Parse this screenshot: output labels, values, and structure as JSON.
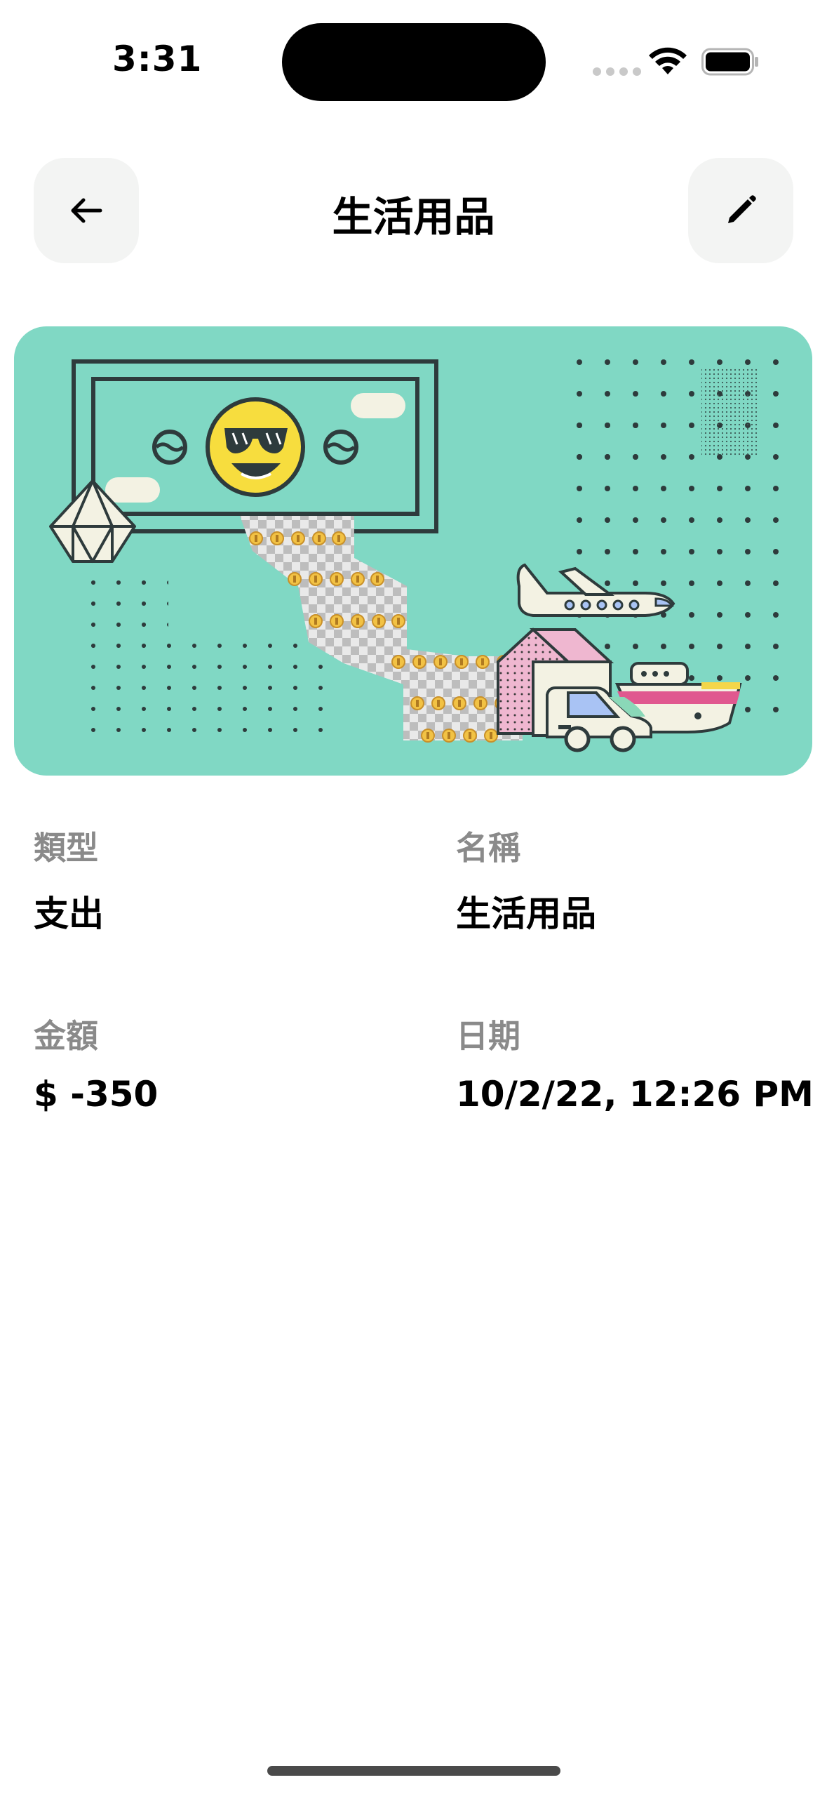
{
  "status_bar": {
    "time": "3:31"
  },
  "nav": {
    "title": "生活用品",
    "back_icon": "arrow-left-icon",
    "edit_icon": "pencil-icon"
  },
  "banner": {
    "illustration": "money-bill-sunglasses-emoji-with-coins-plane-car-boat"
  },
  "details": {
    "type": {
      "label": "類型",
      "value": "支出"
    },
    "name": {
      "label": "名稱",
      "value": "生活用品"
    },
    "amount": {
      "label": "金額",
      "value": "$ -350"
    },
    "date": {
      "label": "日期",
      "value": "10/2/22, 12:26 PM"
    }
  },
  "colors": {
    "banner_bg": "#80d8c4",
    "nav_button_bg": "#f3f4f3",
    "label_gray": "#8a8a8a",
    "emoji_yellow": "#f7dd3e"
  }
}
